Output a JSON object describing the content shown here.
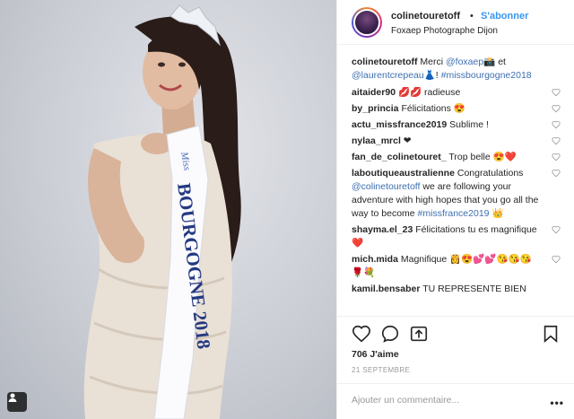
{
  "header": {
    "username": "colinetouretoff",
    "separator": "•",
    "follow_label": "S'abonner",
    "location": "Foxaep Photographe Dijon"
  },
  "caption": {
    "username": "colinetouretoff",
    "text_1": "Merci",
    "mention_1": "@foxaep",
    "emoji_1": "📸",
    "text_2": "et",
    "mention_2": "@laurentcrepeau",
    "emoji_2": "👗",
    "text_3": "!",
    "hashtag": "#missbourgogne2018"
  },
  "comments": [
    {
      "user": "aitaider90",
      "text": "💋💋 radieuse"
    },
    {
      "user": "by_princia",
      "text": "Félicitations 😍"
    },
    {
      "user": "actu_missfrance2019",
      "text": "Sublime !"
    },
    {
      "user": "nylaa_mrcl",
      "text": "❤"
    },
    {
      "user": "fan_de_colinetouret_",
      "text": "Trop belle 😍❤️"
    },
    {
      "user": "laboutiqueaustralienne",
      "text_1": "Congratulations",
      "mention": "@colinetouretoff",
      "text_2": "we are following your adventure with high hopes that you go all the way to become",
      "hashtag": "#missfrance2019",
      "emoji": "👑"
    },
    {
      "user": "shayma.el_23",
      "text": "Félicitations tu es magnifique ❤️"
    },
    {
      "user": "mich.mida",
      "text": "Magnifique 👸😍💕💕😘😘😘🌹💐"
    },
    {
      "user": "kamil.bensaber",
      "text": "TU REPRESENTE BIEN"
    }
  ],
  "actions": {
    "likes": "706 J'aime",
    "date": "21 SEPTEMBRE",
    "comment_placeholder": "Ajouter un commentaire...",
    "more": "•••"
  },
  "photo": {
    "sash_text": "BOURGOGNE 2018",
    "sash_small": "Miss"
  },
  "icons": [
    "heart-icon",
    "comment-icon",
    "share-icon",
    "bookmark-icon",
    "gallery-icon"
  ]
}
